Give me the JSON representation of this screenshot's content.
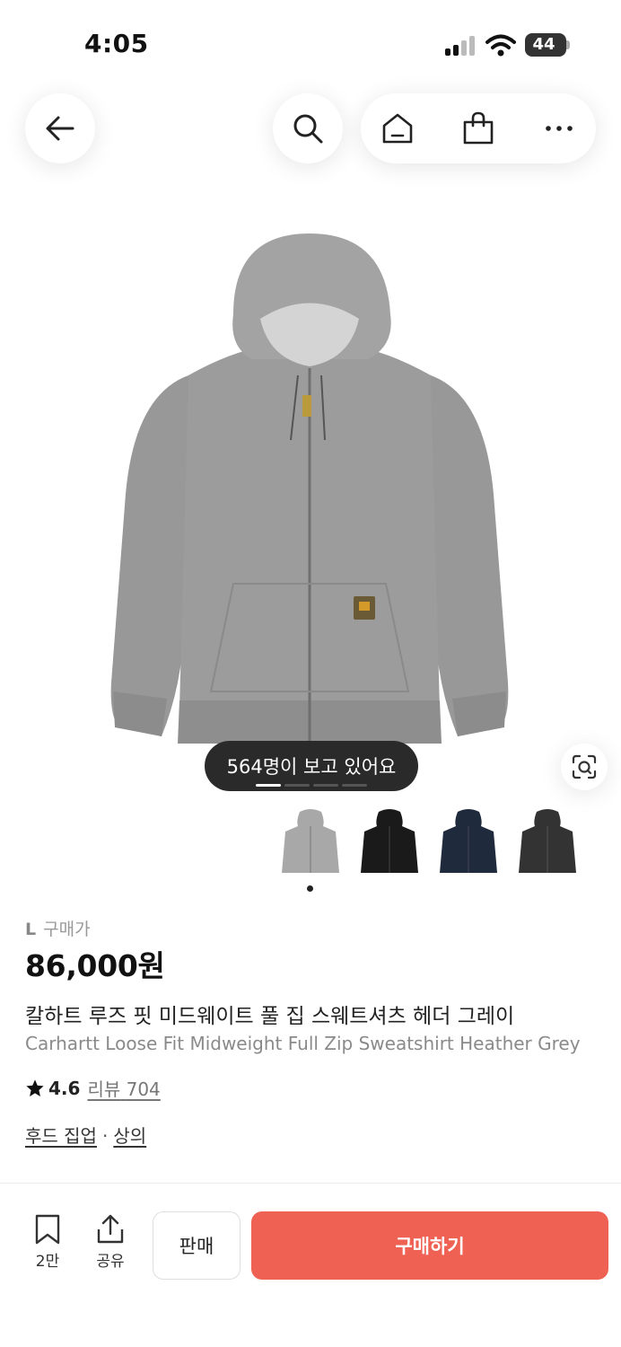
{
  "status_bar": {
    "time": "4:05",
    "battery": "44"
  },
  "nav": {
    "back": "back-arrow-icon",
    "search": "search-icon",
    "home": "home-icon",
    "bag": "shopping-bag-icon",
    "more": "more-icon"
  },
  "product": {
    "viewers_text": "564명이 보고 있어요",
    "image_page": {
      "current": 1,
      "total": 4
    },
    "colors": [
      "Heather Grey",
      "Black",
      "Navy",
      "Charcoal"
    ],
    "selected_color_index": 0,
    "size": "L",
    "price_label": "구매가",
    "price": "86,000원",
    "title_ko": "칼하트 루즈 핏 미드웨이트 풀 집 스웨트셔츠 헤더 그레이",
    "title_en": "Carhartt Loose Fit Midweight Full Zip Sweatshirt Heather Grey",
    "rating": "4.6",
    "review_label": "리뷰",
    "review_count": "704",
    "category_1": "후드 집업",
    "category_sep": "·",
    "category_2": "상의"
  },
  "bottom_bar": {
    "bookmark_count": "2만",
    "share_label": "공유",
    "sell_label": "판매",
    "buy_label": "구매하기"
  },
  "colors": {
    "accent": "#ef6253",
    "pill_bg": "#2a2a2a"
  }
}
